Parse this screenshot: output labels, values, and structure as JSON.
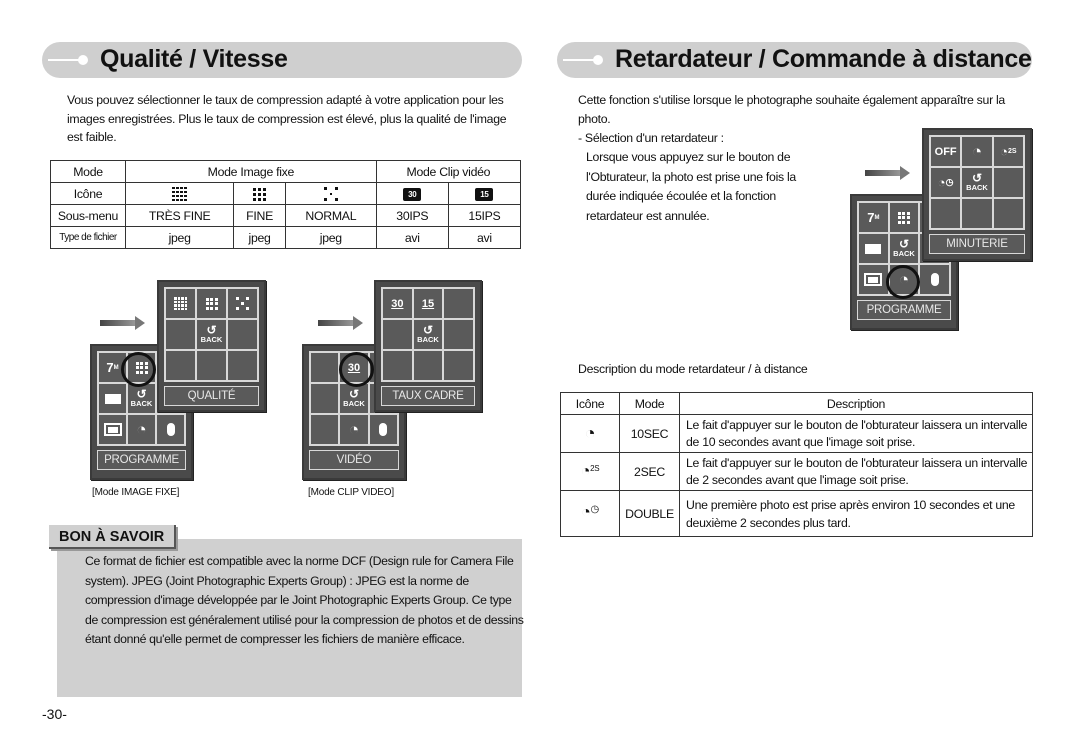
{
  "left": {
    "title": "Qualité / Vitesse",
    "intro": "Vous pouvez sélectionner le taux de compression adapté à votre application pour les images enregistrées. Plus le taux de compression est élevé, plus la qualité de l'image est faible.",
    "table": {
      "mode_label": "Mode",
      "still_label": "Mode Image fixe",
      "clip_label": "Mode Clip vidéo",
      "icon_label": "Icône",
      "submenu_label": "Sous-menu",
      "filetype_label": "Type de fichier",
      "columns": [
        {
          "icon": "very-fine-quality-icon",
          "submenu": "TRÈS FINE",
          "filetype": "jpeg"
        },
        {
          "icon": "fine-quality-icon",
          "submenu": "FINE",
          "filetype": "jpeg"
        },
        {
          "icon": "normal-quality-icon",
          "submenu": "NORMAL",
          "filetype": "jpeg"
        },
        {
          "icon": "30fps-icon",
          "icon_text": "30",
          "submenu": "30IPS",
          "filetype": "avi"
        },
        {
          "icon": "15fps-icon",
          "icon_text": "15",
          "submenu": "15IPS",
          "filetype": "avi"
        }
      ]
    },
    "diagram_still": {
      "front_label": "QUALITÉ",
      "back_label": "PROGRAMME",
      "caption": "[Mode IMAGE FIXE]",
      "size_text": "7",
      "back_text": "BACK"
    },
    "diagram_clip": {
      "front_label": "TAUX CADRE",
      "back_label": "VIDÉO",
      "caption": "[Mode CLIP VIDEO]",
      "fps30": "30",
      "fps15": "15",
      "back_text": "BACK"
    },
    "tip": {
      "heading": "BON À SAVOIR",
      "text": "Ce format de fichier est compatible avec la norme DCF (Design rule for Camera File system). JPEG (Joint Photographic Experts Group) : JPEG est la norme de compression d'image développée par le Joint Photographic Experts Group. Ce type de compression est généralement utilisé pour la compression de photos et de dessins étant donné qu'elle permet de compresser les fichiers de manière efficace."
    },
    "page_number": "-30-"
  },
  "right": {
    "title": "Retardateur / Commande à distance",
    "intro": "Cette fonction s'utilise lorsque le photographe souhaite également apparaître sur la photo.",
    "selection_heading": "- Sélection d'un retardateur :",
    "selection_text": "Lorsque vous appuyez sur le bouton de l'Obturateur, la photo est prise une fois la durée indiquée écoulée et la fonction retardateur est annulée.",
    "diagram": {
      "front_label": "MINUTERIE",
      "back_label": "PROGRAMME",
      "off_text": "OFF",
      "two_s": "2S",
      "size_text": "7",
      "back_text": "BACK"
    },
    "table_caption": "Description du mode retardateur / à distance",
    "table": {
      "headers": [
        "Icône",
        "Mode",
        "Description"
      ],
      "rows": [
        {
          "icon": "timer-10sec-icon",
          "sup": "",
          "mode": "10SEC",
          "description": "Le fait d'appuyer sur le bouton de l'obturateur laissera un intervalle de 10 secondes avant que l'image soit prise."
        },
        {
          "icon": "timer-2sec-icon",
          "sup": "2S",
          "mode": "2SEC",
          "description": "Le fait d'appuyer sur le bouton de l'obturateur laissera un intervalle de 2 secondes avant que l'image soit prise."
        },
        {
          "icon": "timer-double-icon",
          "sup": "◷",
          "mode": "DOUBLE",
          "description": "Une première photo est prise après environ 10 secondes et une deuxième 2 secondes plus tard."
        }
      ]
    }
  }
}
